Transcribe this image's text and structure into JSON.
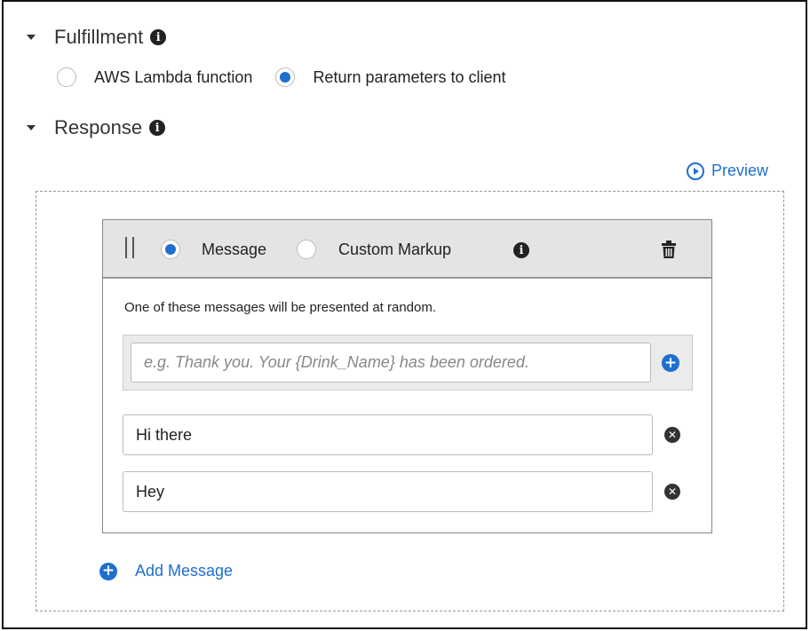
{
  "fulfillment": {
    "title": "Fulfillment",
    "options": [
      {
        "label": "AWS Lambda function",
        "checked": false
      },
      {
        "label": "Return parameters to client",
        "checked": true
      }
    ]
  },
  "response": {
    "title": "Response",
    "preview_label": "Preview",
    "card": {
      "type_options": [
        {
          "label": "Message",
          "checked": true
        },
        {
          "label": "Custom Markup",
          "checked": false
        }
      ],
      "hint": "One of these messages will be presented at random.",
      "new_message_placeholder": "e.g. Thank you. Your {Drink_Name} has been ordered.",
      "messages": [
        "Hi there",
        "Hey"
      ]
    },
    "add_message_label": "Add Message"
  },
  "colors": {
    "accent": "#1f6fcf",
    "header_bg": "#e4e4e4"
  },
  "icons": [
    "caret-down-icon",
    "info-icon",
    "play-circle-icon",
    "drag-handle-icon",
    "trash-icon",
    "plus-circle-icon",
    "remove-circle-icon"
  ]
}
